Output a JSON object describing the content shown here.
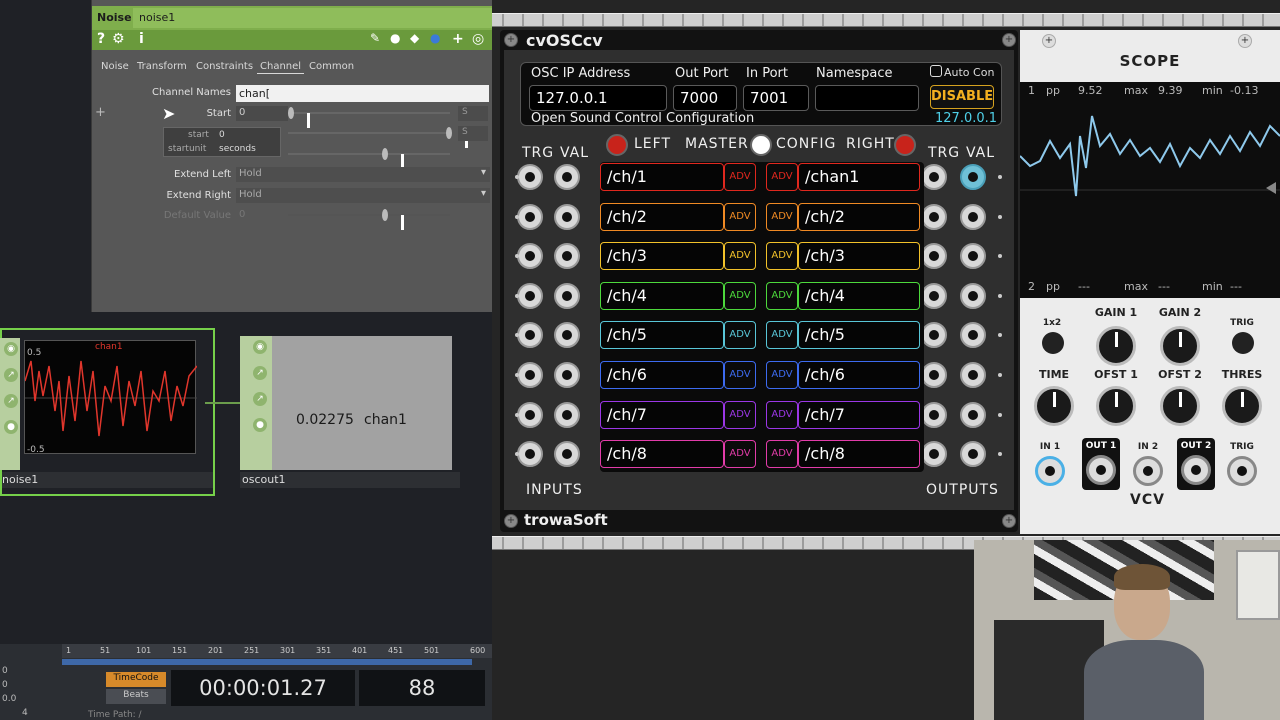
{
  "td": {
    "op_type": "Noise",
    "op_name": "noise1",
    "tabs": [
      "Noise",
      "Transform",
      "Constraints",
      "Channel",
      "Common"
    ],
    "active_tab": "Channel",
    "params": {
      "channel_names_label": "Channel Names",
      "channel_names_value": "chan[",
      "start_label": "Start",
      "start_value": "0",
      "extend_left_label": "Extend Left",
      "extend_left_value": "Hold",
      "extend_right_label": "Extend Right",
      "extend_right_value": "Hold",
      "default_value_label": "Default Value",
      "default_value_value": "0",
      "s_button": "S"
    },
    "tooltip": {
      "row1_k": "start",
      "row1_v": "0",
      "row2_k": "startunit",
      "row2_v": "seconds"
    },
    "nodes": {
      "noise_label": "noise1",
      "noise_chan": "chan1",
      "noise_ymax": "0.5",
      "noise_ymin": "-0.5",
      "oscout_label": "oscout1",
      "oscout_value": "0.02275",
      "oscout_chan": "chan1"
    },
    "timeline": {
      "ticks": [
        "1",
        "51",
        "101",
        "151",
        "201",
        "251",
        "301",
        "351",
        "401",
        "451",
        "501",
        "600"
      ],
      "timecode_label": "TimeCode",
      "beats_label": "Beats",
      "timecode": "00:00:01.27",
      "frame": "88",
      "time_path": "Time Path: /",
      "left_nums": [
        "0",
        "0",
        "0.0",
        "4"
      ]
    }
  },
  "vcv": {
    "osc": {
      "title": "cvOSCcv",
      "brand": "trowaSoft",
      "labels": {
        "ip": "OSC IP Address",
        "out_port": "Out Port",
        "in_port": "In Port",
        "namespace": "Namespace"
      },
      "ip": "127.0.0.1",
      "out_port": "7000",
      "in_port": "7001",
      "namespace": "",
      "subtitle": "Open Sound Control Configuration",
      "auto_con": "Auto Con",
      "disable": "DISABLE",
      "ip_display": "127.0.0.1",
      "sections": {
        "left": "LEFT",
        "master": "MASTER",
        "config": "CONFIG",
        "right": "RIGHT"
      },
      "trg": "TRG",
      "val": "VAL",
      "inputs": "INPUTS",
      "outputs": "OUTPUTS",
      "adv": "ADV",
      "left_channels": [
        "/ch/1",
        "/ch/2",
        "/ch/3",
        "/ch/4",
        "/ch/5",
        "/ch/6",
        "/ch/7",
        "/ch/8"
      ],
      "right_channels": [
        "/chan1",
        "/ch/2",
        "/ch/3",
        "/ch/4",
        "/ch/5",
        "/ch/6",
        "/ch/7",
        "/ch/8"
      ],
      "channel_colors": [
        "#e0281e",
        "#f08a24",
        "#f2c22a",
        "#4dd93c",
        "#59c6d8",
        "#3d6bf0",
        "#9b37e6",
        "#e23ca9"
      ]
    },
    "scope": {
      "title": "SCOPE",
      "row1": [
        "1",
        "pp",
        "9.52",
        "max",
        "9.39",
        "min",
        "-0.13"
      ],
      "row2": [
        "2",
        "pp",
        "---",
        "max",
        "---",
        "min",
        "---"
      ],
      "knob_labels": {
        "x2": "1x2",
        "gain1": "GAIN 1",
        "gain2": "GAIN 2",
        "trig": "TRIG",
        "time": "TIME",
        "ofst1": "OFST 1",
        "ofst2": "OFST 2",
        "thres": "THRES"
      },
      "jacks": {
        "in1": "IN 1",
        "out1": "OUT 1",
        "in2": "IN 2",
        "out2": "OUT 2",
        "trig": "TRIG"
      },
      "logo": "VCV"
    }
  }
}
